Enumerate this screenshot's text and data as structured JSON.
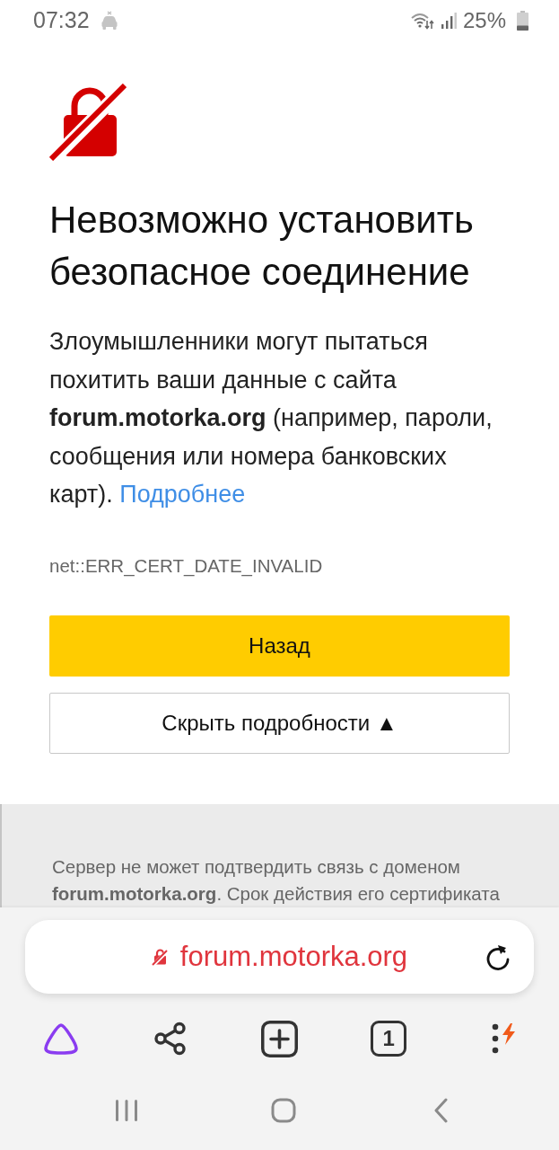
{
  "status_bar": {
    "time": "07:32",
    "battery": "25%"
  },
  "error_page": {
    "title": "Невозможно установить безопасное соединение",
    "description": "Злоумышленники могут пытаться похитить ваши данные с сайта **forum.motorka.org** (например, пароли, сообщения или номера банковских карт).",
    "link": "Подробнее",
    "error_code": "net::ERR_CERT_DATE_INVALID",
    "buttons": [
      {
        "kind": "primary",
        "label": "Назад"
      },
      {
        "kind": "secondary",
        "label": "Скрыть подробности ▲"
      }
    ]
  },
  "details": {
    "text": "Сервер не может подтвердить связь с доменом **forum.motorka.org**. Срок действия его сертификата"
  },
  "address_bar": {
    "url": "forum.motorka.org"
  },
  "toolbar": {
    "tab_count": "1"
  }
}
